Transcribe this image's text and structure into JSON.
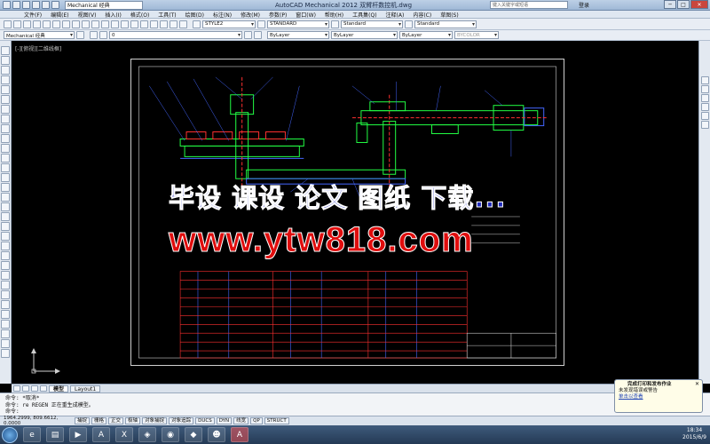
{
  "window": {
    "title": "AutoCAD Mechanical 2012   双臂杆数控机.dwg",
    "workspace": "Mechanical 经典",
    "search_placeholder": "键入关键字或短语",
    "login": "登录",
    "controls": {
      "minimize": "─",
      "maximize": "□",
      "close": "✕"
    }
  },
  "menu": [
    "文件(F)",
    "编辑(E)",
    "视图(V)",
    "插入(I)",
    "格式(O)",
    "工具(T)",
    "绘图(D)",
    "标注(N)",
    "修改(M)",
    "参数(P)",
    "窗口(W)",
    "帮助(H)",
    "工具集(Q)",
    "注释(A)",
    "内容(C)",
    "草图(S)"
  ],
  "toolbar1": {
    "text_style": "STYLE2",
    "dim_style": "STANDARD",
    "table_style": "Standard",
    "mleader_style": "Standard"
  },
  "toolbar2": {
    "workspace": "Mechanical 经典",
    "layer": "0",
    "color": "ByLayer",
    "linetype": "ByLayer",
    "lineweight": "ByLayer",
    "plotstyle": "BYCOLOR"
  },
  "viewport_label": "[-][俯视][二维线框]",
  "watermark": {
    "line1": "毕设 课设 论文 图纸 下载...",
    "line2": "www.ytw818.com"
  },
  "layout_tabs": {
    "model": "模型",
    "layout1": "Layout1"
  },
  "command_line": [
    "命令:  *取消*",
    "命令:  re REGEN 正在重生成模型。",
    "命令:"
  ],
  "status": {
    "coords": "1964.2999, 809.6612, 0.0000",
    "mode": "STRUCT",
    "modes": [
      "捕捉",
      "栅格",
      "正交",
      "极轴",
      "对象捕捉",
      "对象追踪",
      "DUCS",
      "DYN",
      "线宽",
      "QP"
    ]
  },
  "notification": {
    "title": "完成打印和发布作业",
    "line": "未发现错误或警告",
    "link": "单击以查看"
  },
  "clock": {
    "time": "18:34",
    "date": "2015/6/9"
  },
  "colors": {
    "canvas": "#000000",
    "watermark_blue": "#1f2bbd",
    "watermark_red": "#e00d0d",
    "drawing_green": "#22ff44",
    "drawing_red": "#ff3030",
    "drawing_blue": "#4466ff"
  }
}
